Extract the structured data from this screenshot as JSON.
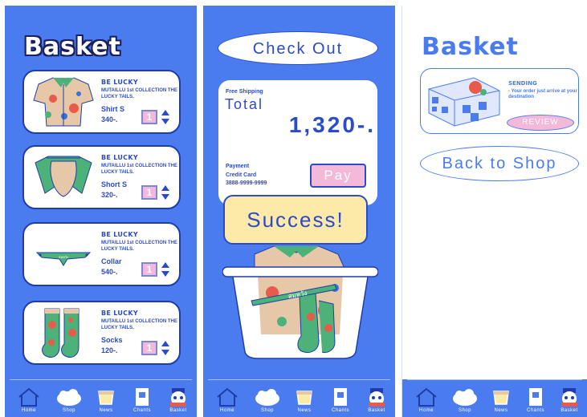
{
  "colors": {
    "primary": "#4a7cf0",
    "navy": "#1f3da8",
    "pink": "#f4b8d8",
    "yellow": "#fde9a8",
    "white": "#ffffff"
  },
  "nav": {
    "items": [
      {
        "label": "Home",
        "icon": "home-icon"
      },
      {
        "label": "Shop",
        "icon": "shop-icon"
      },
      {
        "label": "News",
        "icon": "news-icon"
      },
      {
        "label": "Chants",
        "icon": "chants-icon"
      },
      {
        "label": "Basket",
        "icon": "basket-icon"
      }
    ]
  },
  "screen1": {
    "title": "Basket",
    "items": [
      {
        "brand": "BE LUCKY",
        "collection": "MUTAILLU 1st COLLECTION THE LUCKY TAILS.",
        "name": "Shirt S",
        "price": "340-.",
        "qty": "1"
      },
      {
        "brand": "BE LUCKY",
        "collection": "MUTAILLU 1st COLLECTION THE LUCKY TAILS.",
        "name": "Short S",
        "price": "320-.",
        "qty": "1"
      },
      {
        "brand": "BE LUCKY",
        "collection": "MUTAILLU 1st COLLECTION THE LUCKY TAILS.",
        "name": "Collar",
        "price": "540-.",
        "qty": "1"
      },
      {
        "brand": "BE LUCKY",
        "collection": "MUTAILLU 1st COLLECTION THE LUCKY TAILS.",
        "name": "Socks",
        "price": "120-.",
        "qty": "1"
      }
    ]
  },
  "screen2": {
    "checkout_label": "Check Out",
    "shipping": "Free Shipping",
    "total_label": "Total",
    "total_value": "1,320-.",
    "payment_label": "Payment",
    "card_label": "Credit Card",
    "card_number": "3888-9999-9999",
    "pay_label": "Pay",
    "success_label": "Success!",
    "collar_text": "สมหวัง"
  },
  "screen3": {
    "title": "Basket",
    "sending_title": "SENDING",
    "sending_text": "- Your order just arrive at your destination",
    "review_label": "REVIEW",
    "back_label": "Back to Shop"
  }
}
